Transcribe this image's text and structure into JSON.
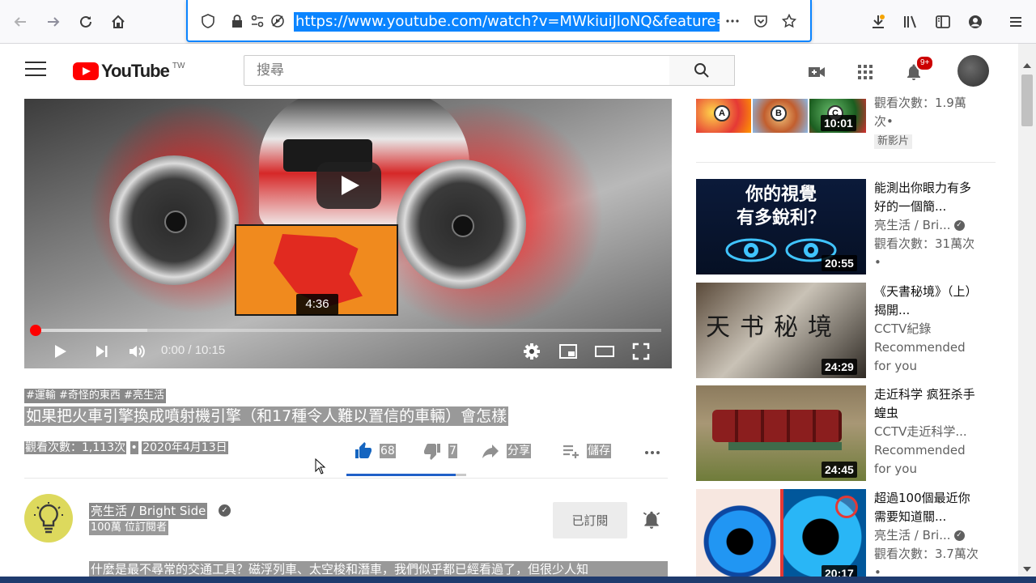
{
  "browser": {
    "url": "https://www.youtube.com/watch?v=MWkiuiJloNQ&feature=pus",
    "icons": [
      "back-icon",
      "forward-icon",
      "reload-icon",
      "home-icon",
      "shield-icon",
      "lock-icon",
      "permissions-icon",
      "autoplay-blocked-icon",
      "more-icon",
      "pocket-icon",
      "bookmark-star-icon",
      "download-icon",
      "library-icon",
      "sidebar-icon",
      "account-icon",
      "menu-icon"
    ]
  },
  "header": {
    "logo_text": "YouTube",
    "logo_suffix": "TW",
    "search_placeholder": "搜尋",
    "notification_count": "9+"
  },
  "player": {
    "preview_time": "4:36",
    "time_display": "0:00 / 10:15",
    "progress_fraction": 0.0,
    "buffer_fraction": 0.18
  },
  "video": {
    "hashtags": "#運輸 #奇怪的東西 #亮生活",
    "title": "如果把火車引擎換成噴射機引擎（和17種令人難以置信的車輛）會怎樣",
    "views": "觀看次數：1,113次",
    "separator": "•",
    "date": "2020年4月13日",
    "likes": "68",
    "dislikes": "7",
    "share_label": "分享",
    "save_label": "儲存",
    "like_ratio": 0.91
  },
  "channel": {
    "name": "亮生活 / Bright Side",
    "subscribers": "100萬 位訂閱者",
    "subscribed_label": "已訂閱",
    "description": "什麼是最不尋常的交通工具？磁浮列車、太空梭和潛車，我們似乎都已經看過了，但很少人知"
  },
  "recommendations": [
    {
      "duration": "10:01",
      "line1": "觀看次數：1.9萬",
      "line2": "次•",
      "line3": "新影片",
      "letters": [
        "A",
        "B",
        "C"
      ]
    },
    {
      "title": "能測出你眼力有多好的一個簡...",
      "channel": "亮生活 / Bri...",
      "views": "觀看次數：31萬次•",
      "duration": "20:55",
      "thumb_text_1": "你的視覺",
      "thumb_text_2": "有多銳利？"
    },
    {
      "title": "《天書秘境》（上）揭開...",
      "channel": "CCTV紀錄",
      "views": "Recommended for you",
      "duration": "24:29",
      "thumb_text_1": "天书秘境"
    },
    {
      "title": "走近科学 疯狂杀手 蝗虫",
      "channel": "CCTV走近科学...",
      "views": "Recommended for you",
      "duration": "24:45"
    },
    {
      "title": "超過100個最近你需要知道關...",
      "channel": "亮生活 / Bri...",
      "views": "觀看次數：3.7萬次•",
      "duration": "20:17"
    }
  ]
}
